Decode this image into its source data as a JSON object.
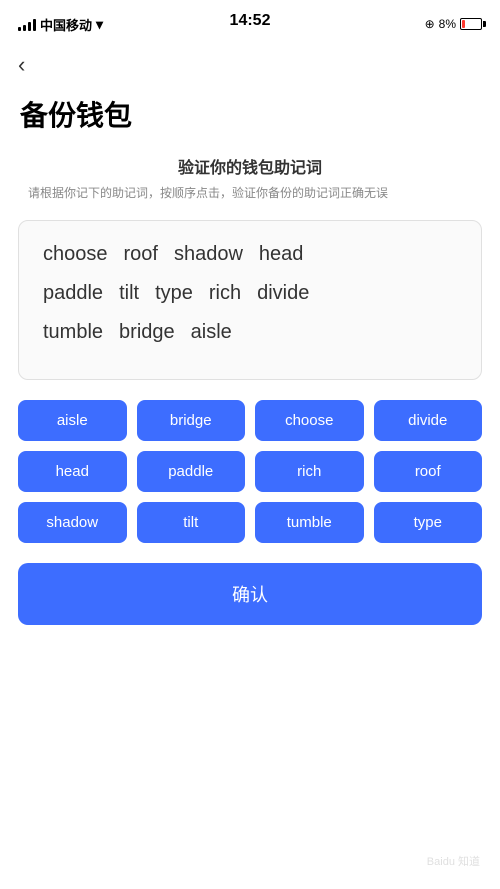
{
  "statusBar": {
    "carrier": "中国移动",
    "time": "14:52",
    "batteryPercent": "8%"
  },
  "nav": {
    "backLabel": "‹"
  },
  "page": {
    "title": "备份钱包",
    "sectionTitle": "验证你的钱包助记词",
    "sectionDesc": "请根据你记下的助记词，按顺序点击，验证你备份的助记词正确无误"
  },
  "displayWords": {
    "row1": [
      "choose",
      "roof",
      "shadow",
      "head"
    ],
    "row2": [
      "paddle",
      "tilt",
      "type",
      "rich",
      "divide"
    ],
    "row3": [
      "tumble",
      "bridge",
      "aisle"
    ]
  },
  "wordButtons": [
    "aisle",
    "bridge",
    "choose",
    "divide",
    "head",
    "paddle",
    "rich",
    "roof",
    "shadow",
    "tilt",
    "tumble",
    "type"
  ],
  "confirmBtn": "确认"
}
